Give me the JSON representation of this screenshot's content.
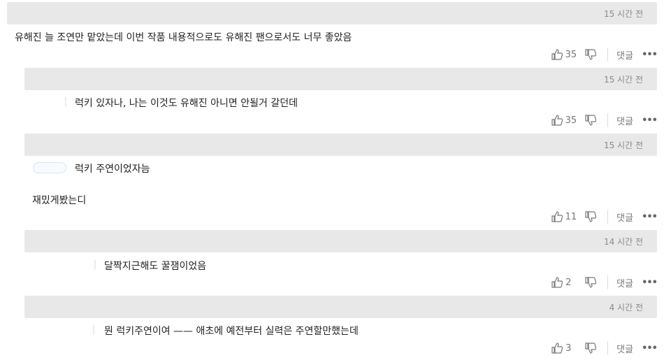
{
  "ui": {
    "reply_label": "댓글",
    "more_label": "•••"
  },
  "comments": [
    {
      "time": "15 시간 전",
      "text": "유해진 늘 조연만 맡았는데 이번 작품 내용적으로도 유해진 팬으로서도 너무 좋았음",
      "likes": "35"
    },
    {
      "time": "15 시간 전",
      "text": "럭키 있자나, 나는 이것도 유해진 아니면 안될거 갈던데",
      "likes": "35"
    },
    {
      "time": "15 시간 전",
      "text": "럭키 주연이었자늠",
      "text2": "재밌게봤는디",
      "likes": "11"
    },
    {
      "time": "14 시간 전",
      "text": "달짝지근해도 꿀잼이었음",
      "likes": "2"
    },
    {
      "time": "4 시간 전",
      "text": "뭔 럭키주연이여 —— 애초에 예전부터 실력은 주연할만했는데",
      "likes": "3"
    }
  ]
}
